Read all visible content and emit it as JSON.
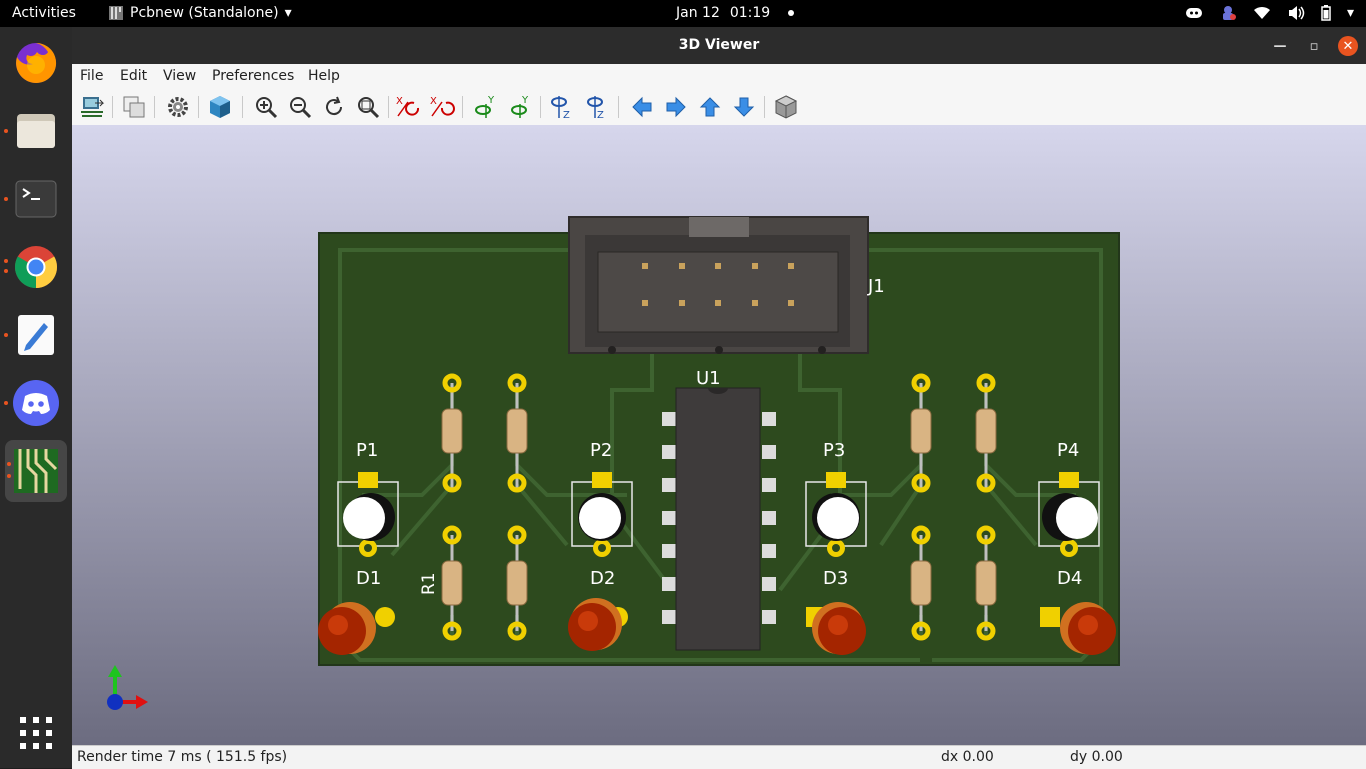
{
  "topbar": {
    "activities": "Activities",
    "app_name": "Pcbnew (Standalone)",
    "date": "Jan 12",
    "time": "01:19"
  },
  "dock": {
    "items": [
      "firefox-icon",
      "files-icon",
      "terminal-icon",
      "chrome-icon",
      "text-editor-icon",
      "discord-icon",
      "pcbnew-icon",
      "show-apps-icon"
    ]
  },
  "window": {
    "title": "3D Viewer",
    "menu": [
      "File",
      "Edit",
      "View",
      "Preferences",
      "Help"
    ]
  },
  "pcb": {
    "connector_label": "J1",
    "ic_label": "U1",
    "pot_labels": [
      "P1",
      "P2",
      "P3",
      "P4"
    ],
    "led_labels": [
      "D1",
      "D2",
      "D3",
      "D4"
    ],
    "resistor_label": "R1",
    "colors": {
      "board": "#2f4a1f",
      "board_edge": "#243a18",
      "track": "#3f6330",
      "pad": "#f0d000",
      "connector": "#4a4644",
      "ic": "#3e3b3b",
      "led": "#b02800",
      "resistor": "#d9b483"
    }
  },
  "status": {
    "render": "Render time 7 ms ( 151.5 fps)",
    "dx": "dx 0.00",
    "dy": "dy 0.00"
  }
}
